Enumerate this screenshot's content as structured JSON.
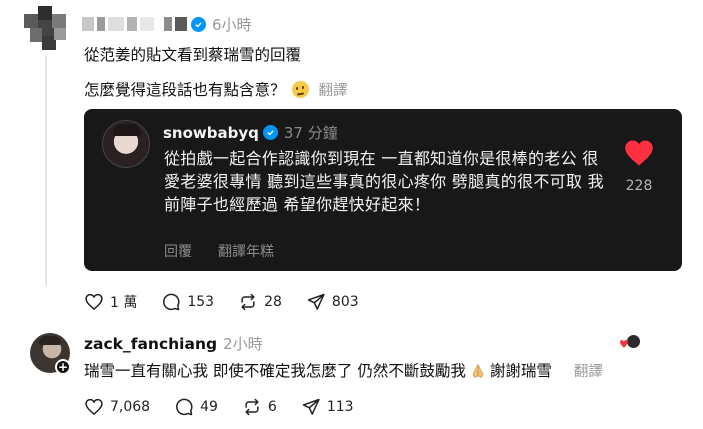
{
  "post": {
    "time": "6小時",
    "line1": "從范姜的貼文看到蔡瑞雪的回覆",
    "line2": "怎麼覺得這段話也有點含意？",
    "emoji": "thinking-face",
    "translate": "翻譯",
    "stats": {
      "likes": "1 萬",
      "comments": "153",
      "reposts": "28",
      "shares": "803"
    }
  },
  "quote": {
    "username": "snowbabyq",
    "time": "37 分鐘",
    "text": "從拍戲一起合作認識你到現在 一直都知道你是很棒的老公 很愛老婆很專情 聽到這些事真的很心疼你 劈腿真的很不可取 我前陣子也經歷過 希望你趕快好起來！",
    "reply_label": "回覆",
    "translate_label": "翻譯年糕",
    "like_count": "228",
    "heart_color": "#ff3040"
  },
  "reply": {
    "username": "zack_fanchiang",
    "time": "2小時",
    "text_before": "瑞雪一直有關心我 即使不確定我怎麼了 仍然不斷鼓勵我",
    "emoji": "folded-hands",
    "text_after": "謝謝瑞雪",
    "translate": "翻譯",
    "stats": {
      "likes": "7,068",
      "comments": "49",
      "reposts": "6",
      "shares": "113"
    }
  },
  "colors": {
    "verified": "#0095f6",
    "muted": "#999999",
    "card_bg": "#181818"
  }
}
